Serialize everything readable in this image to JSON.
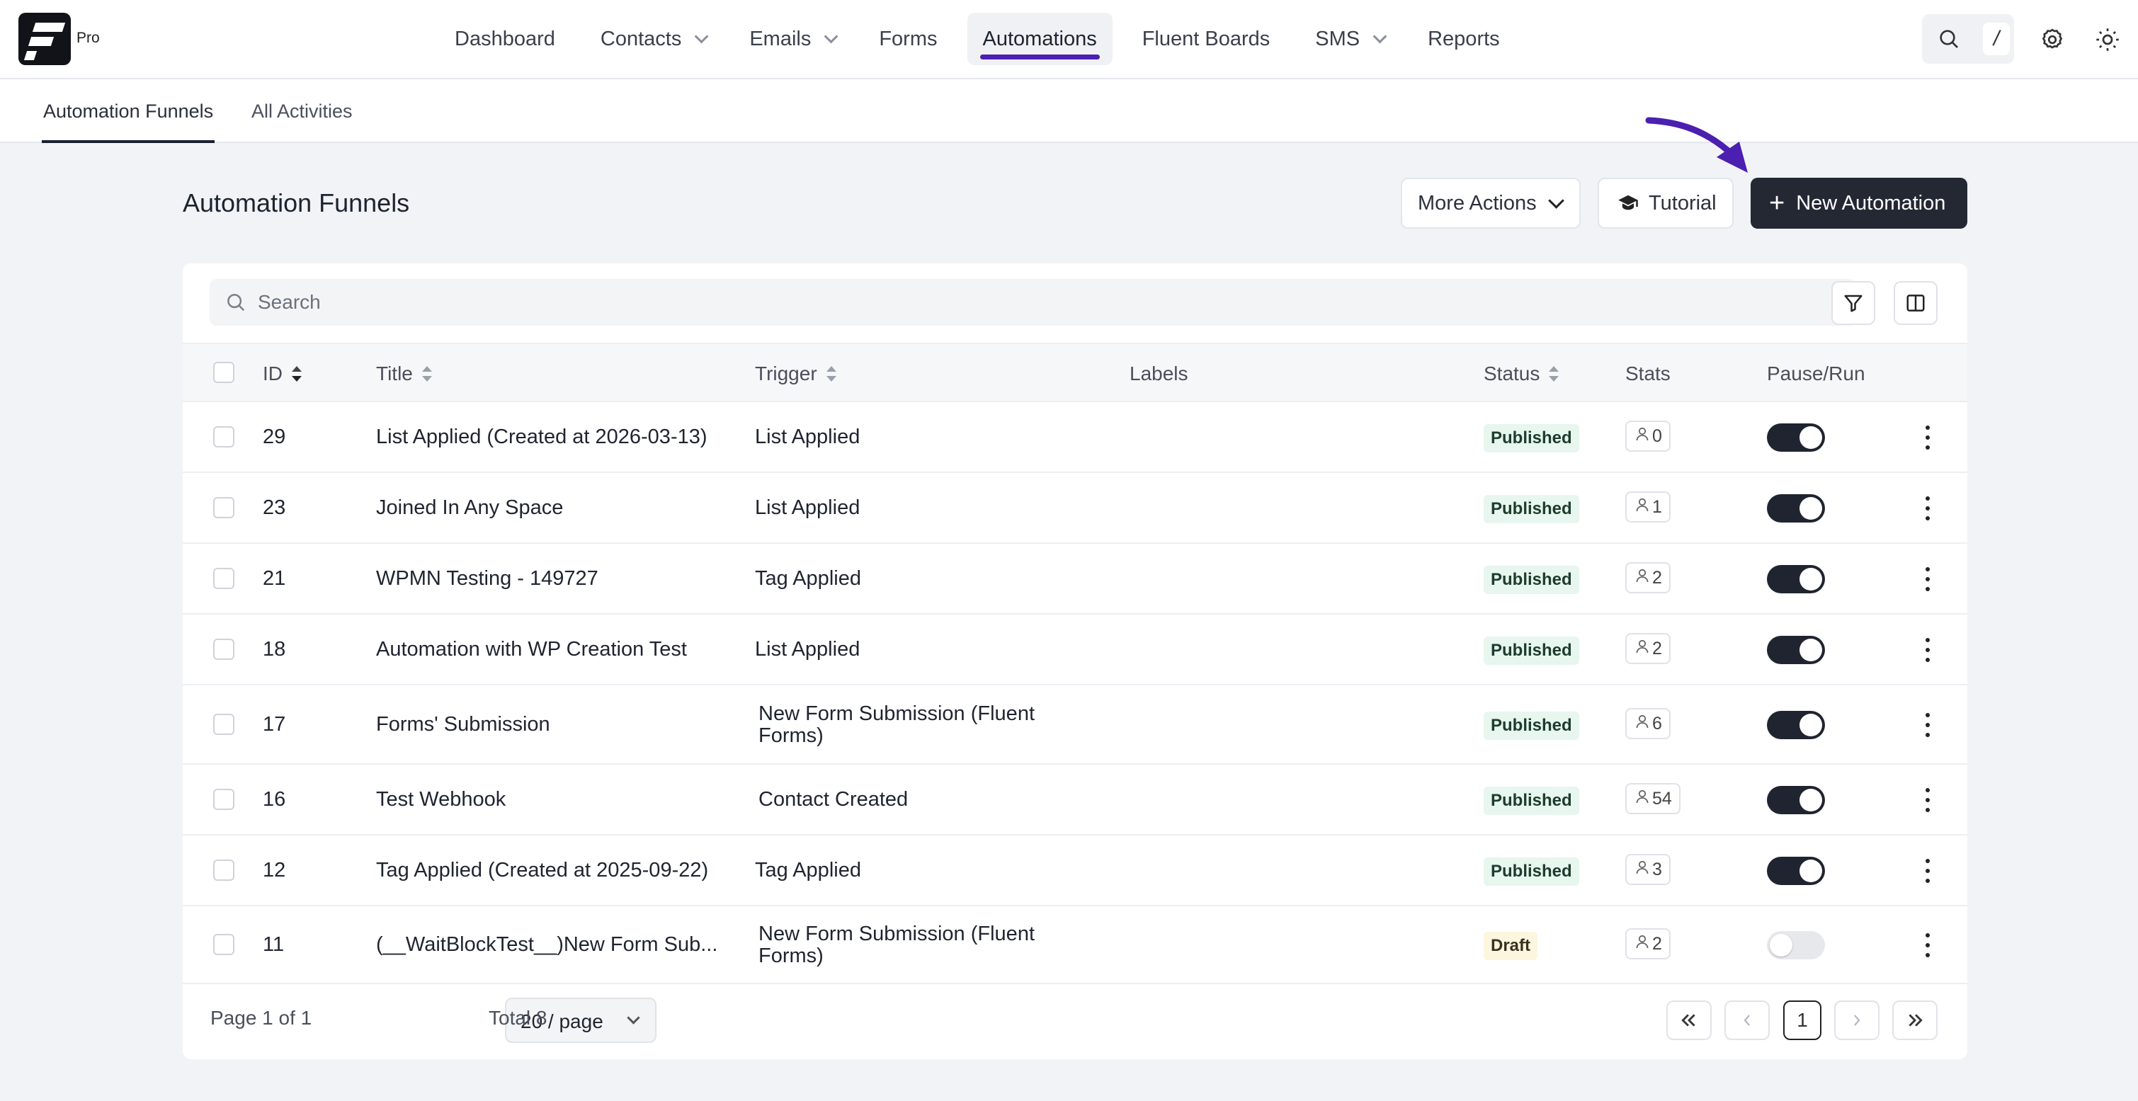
{
  "app": {
    "logo_suffix": "Pro"
  },
  "nav": {
    "items": [
      {
        "label": "Dashboard",
        "dropdown": false
      },
      {
        "label": "Contacts",
        "dropdown": true
      },
      {
        "label": "Emails",
        "dropdown": true
      },
      {
        "label": "Forms",
        "dropdown": false
      },
      {
        "label": "Automations",
        "dropdown": false,
        "active": true
      },
      {
        "label": "Fluent Boards",
        "dropdown": false
      },
      {
        "label": "SMS",
        "dropdown": true
      },
      {
        "label": "Reports",
        "dropdown": false
      }
    ],
    "search_shortcut": "/"
  },
  "subtabs": {
    "automation_funnels": "Automation Funnels",
    "all_activities": "All Activities"
  },
  "header": {
    "title": "Automation Funnels",
    "more_actions": "More Actions",
    "tutorial": "Tutorial",
    "new_automation": "New Automation"
  },
  "search": {
    "placeholder": "Search",
    "value": ""
  },
  "table": {
    "columns": {
      "id": "ID",
      "title": "Title",
      "trigger": "Trigger",
      "labels": "Labels",
      "status": "Status",
      "stats": "Stats",
      "pause_run": "Pause/Run"
    },
    "rows": [
      {
        "id": "29",
        "title": "List Applied (Created at 2026-03-13)",
        "trigger": "List Applied",
        "trigger2": "",
        "status": "Published",
        "stats": "0",
        "running": true
      },
      {
        "id": "23",
        "title": "Joined In Any Space",
        "trigger": "List Applied",
        "trigger2": "",
        "status": "Published",
        "stats": "1",
        "running": true
      },
      {
        "id": "21",
        "title": "WPMN Testing - 149727",
        "trigger": "Tag Applied",
        "trigger2": "",
        "status": "Published",
        "stats": "2",
        "running": true
      },
      {
        "id": "18",
        "title": "Automation with WP Creation Test",
        "trigger": "List Applied",
        "trigger2": "",
        "status": "Published",
        "stats": "2",
        "running": true
      },
      {
        "id": "17",
        "title": "Forms' Submission",
        "trigger": "New Form Submission (Fluent",
        "trigger2": "Forms)",
        "status": "Published",
        "stats": "6",
        "running": true
      },
      {
        "id": "16",
        "title": "Test Webhook",
        "trigger": "Contact Created",
        "trigger2": "",
        "status": "Published",
        "stats": "54",
        "running": true
      },
      {
        "id": "12",
        "title": "Tag Applied (Created at 2025-09-22)",
        "trigger": "Tag Applied",
        "trigger2": "",
        "status": "Published",
        "stats": "3",
        "running": true
      },
      {
        "id": "11",
        "title": "(__WaitBlockTest__)New Form Sub...",
        "trigger": "New Form Submission (Fluent",
        "trigger2": "Forms)",
        "status": "Draft",
        "stats": "2",
        "running": false
      }
    ]
  },
  "pagination": {
    "page_info": "Page 1 of 1",
    "per_page": "20 / page",
    "total": "Total 8",
    "current_page": "1"
  },
  "colors": {
    "accent": "#4b1fb0",
    "primary_button": "#232833",
    "published_bg": "#e7f6ee",
    "draft_bg": "#fdf6df"
  }
}
